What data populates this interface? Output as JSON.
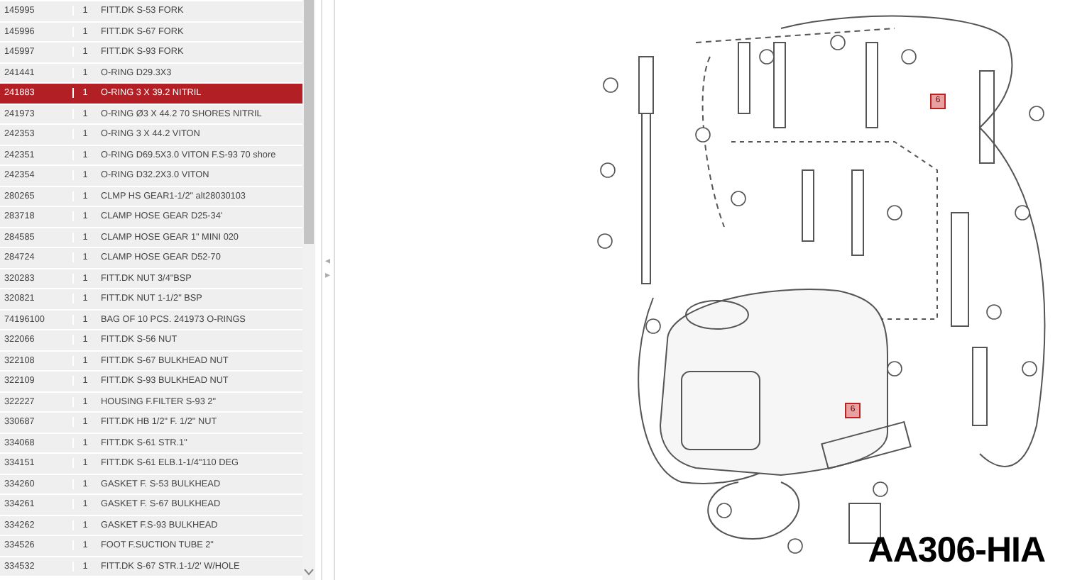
{
  "parts_table": {
    "rows": [
      {
        "code": "145995",
        "qty": "1",
        "description": "FITT.DK S-53 FORK",
        "selected": false
      },
      {
        "code": "145996",
        "qty": "1",
        "description": "FITT.DK S-67 FORK",
        "selected": false
      },
      {
        "code": "145997",
        "qty": "1",
        "description": "FITT.DK S-93 FORK",
        "selected": false
      },
      {
        "code": "241441",
        "qty": "1",
        "description": "O-RING D29.3X3",
        "selected": false
      },
      {
        "code": "241883",
        "qty": "1",
        "description": "O-RING 3 X 39.2 NITRIL",
        "selected": true
      },
      {
        "code": "241973",
        "qty": "1",
        "description": "O-RING Ø3 X 44.2 70 SHORES NITRIL",
        "selected": false
      },
      {
        "code": "242353",
        "qty": "1",
        "description": "O-RING 3 X 44.2 VITON",
        "selected": false
      },
      {
        "code": "242351",
        "qty": "1",
        "description": "O-RING D69.5X3.0 VITON F.S-93 70 shore",
        "selected": false
      },
      {
        "code": "242354",
        "qty": "1",
        "description": "O-RING D32.2X3.0 VITON",
        "selected": false
      },
      {
        "code": "280265",
        "qty": "1",
        "description": "CLMP HS GEAR1-1/2\" alt28030103",
        "selected": false
      },
      {
        "code": "283718",
        "qty": "1",
        "description": "CLAMP HOSE GEAR D25-34'",
        "selected": false
      },
      {
        "code": "284585",
        "qty": "1",
        "description": "CLAMP HOSE GEAR 1\" MINI 020",
        "selected": false
      },
      {
        "code": "284724",
        "qty": "1",
        "description": "CLAMP HOSE GEAR D52-70",
        "selected": false
      },
      {
        "code": "320283",
        "qty": "1",
        "description": "FITT.DK NUT 3/4\"BSP",
        "selected": false
      },
      {
        "code": "320821",
        "qty": "1",
        "description": "FITT.DK NUT 1-1/2\" BSP",
        "selected": false
      },
      {
        "code": "74196100",
        "qty": "1",
        "description": "BAG OF 10 PCS. 241973 O-RINGS",
        "selected": false
      },
      {
        "code": "322066",
        "qty": "1",
        "description": "FITT.DK S-56 NUT",
        "selected": false
      },
      {
        "code": "322108",
        "qty": "1",
        "description": "FITT.DK S-67 BULKHEAD NUT",
        "selected": false
      },
      {
        "code": "322109",
        "qty": "1",
        "description": "FITT.DK S-93 BULKHEAD NUT",
        "selected": false
      },
      {
        "code": "322227",
        "qty": "1",
        "description": "HOUSING F.FILTER S-93 2\"",
        "selected": false
      },
      {
        "code": "330687",
        "qty": "1",
        "description": "FITT.DK HB 1/2\" F. 1/2\" NUT",
        "selected": false
      },
      {
        "code": "334068",
        "qty": "1",
        "description": "FITT.DK S-61 STR.1\"",
        "selected": false
      },
      {
        "code": "334151",
        "qty": "1",
        "description": "FITT.DK S-61 ELB.1-1/4\"110 DEG",
        "selected": false
      },
      {
        "code": "334260",
        "qty": "1",
        "description": "GASKET F. S-53 BULKHEAD",
        "selected": false
      },
      {
        "code": "334261",
        "qty": "1",
        "description": "GASKET F. S-67 BULKHEAD",
        "selected": false
      },
      {
        "code": "334262",
        "qty": "1",
        "description": "GASKET F.S-93 BULKHEAD",
        "selected": false
      },
      {
        "code": "334526",
        "qty": "1",
        "description": "FOOT F.SUCTION TUBE 2\"",
        "selected": false
      },
      {
        "code": "334532",
        "qty": "1",
        "description": "FITT.DK S-67 STR.1-1/2' W/HOLE",
        "selected": false
      }
    ]
  },
  "splitter": {
    "arrows": [
      "◂",
      "▸"
    ]
  },
  "diagram": {
    "hotspots": [
      {
        "label": "6"
      },
      {
        "label": "6"
      }
    ],
    "title": "AA306-HIA"
  }
}
